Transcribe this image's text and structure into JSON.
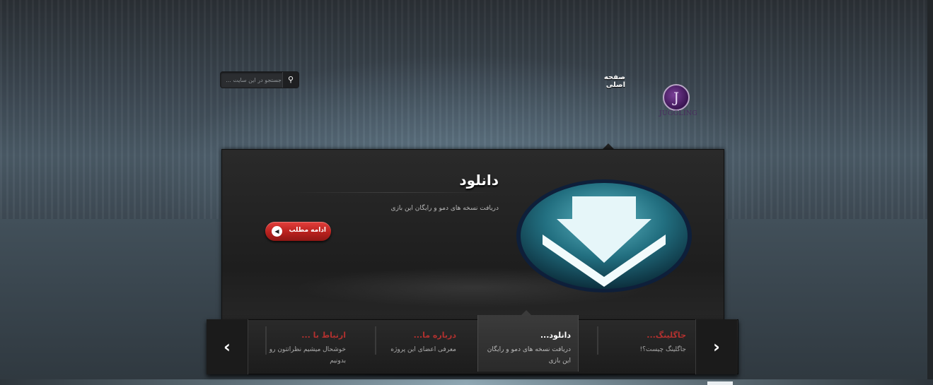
{
  "search": {
    "placeholder": "جستجو در این سایت ..."
  },
  "nav": {
    "home": "صفحه اصلی"
  },
  "logo": {
    "letter": "J",
    "text": "JUGGLING"
  },
  "slide": {
    "title": "دانلود",
    "description": "دریافت نسخه های دمو و رایگان این بازی",
    "more_button": "ادامه مطلب"
  },
  "carousel": {
    "prev_arrow": "‹",
    "next_arrow": "›",
    "items": [
      {
        "title": "جاگلینگ...",
        "text": "جاگلینگ چیست؟!"
      },
      {
        "title": "دانلود...",
        "text": "دریافت نسخه های دمو و رایگان این بازی"
      },
      {
        "title": "درباره ما...",
        "text": "معرفی اعضای این پروژه"
      },
      {
        "title": "ارتباط با ...",
        "text": "خوشحال میشیم نظراتتون رو بدونیم"
      }
    ]
  },
  "colors": {
    "accent_red": "#b8211e",
    "download_teal": "#1e6f7f"
  }
}
